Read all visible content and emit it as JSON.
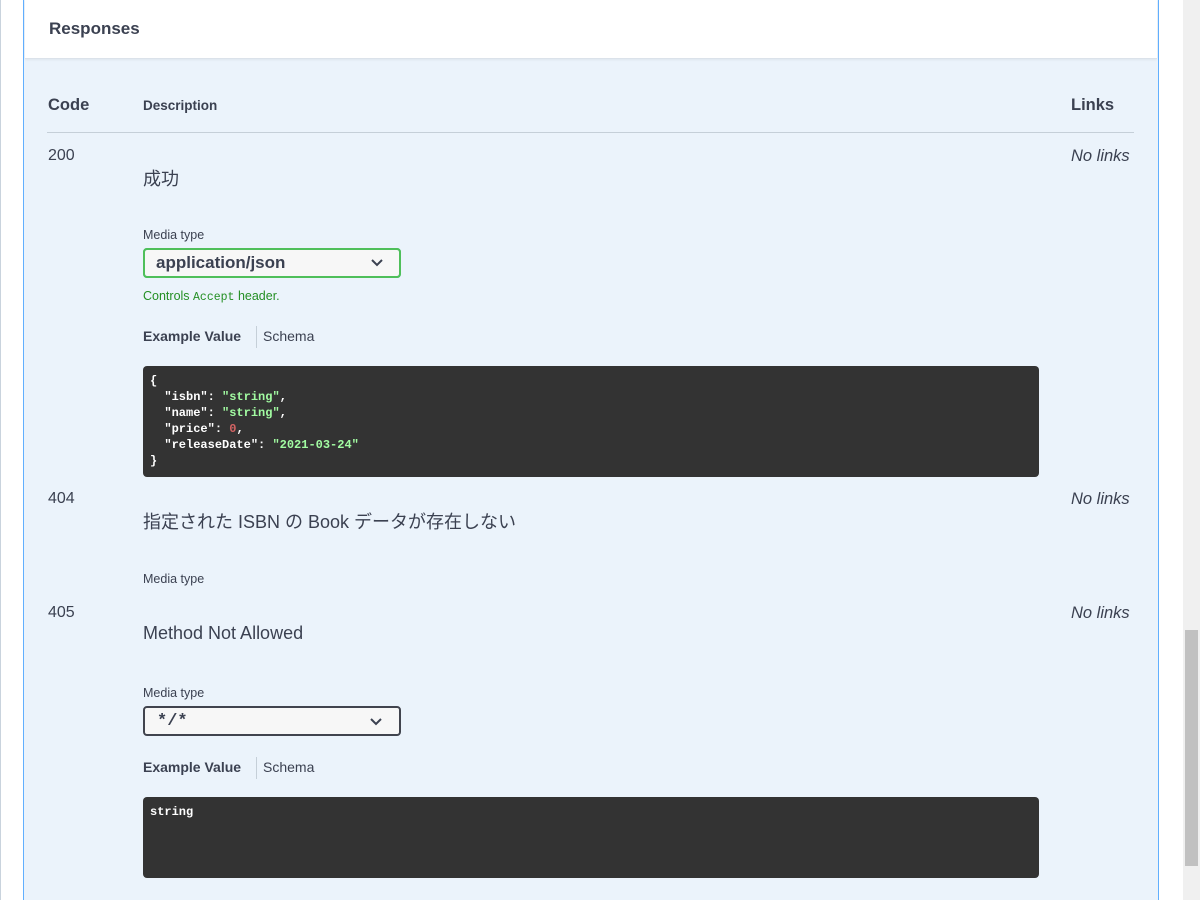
{
  "responses": {
    "title": "Responses",
    "columns": {
      "code": "Code",
      "description": "Description",
      "links": "Links"
    },
    "items": [
      {
        "code": "200",
        "description": "成功",
        "links": "No links",
        "media_type_label": "Media type",
        "media_type_value": "application/json",
        "controls_prefix": "Controls",
        "controls_code": "Accept",
        "controls_suffix": "header.",
        "tab_example": "Example Value",
        "tab_schema": "Schema",
        "example": [
          {
            "text": "{",
            "type": "plain"
          },
          {
            "key": "\"isbn\"",
            "value": "\"string\"",
            "type": "str",
            "trail": ","
          },
          {
            "key": "\"name\"",
            "value": "\"string\"",
            "type": "str",
            "trail": ","
          },
          {
            "key": "\"price\"",
            "value": "0",
            "type": "num",
            "trail": ","
          },
          {
            "key": "\"releaseDate\"",
            "value": "\"2021-03-24\"",
            "type": "str",
            "trail": ""
          },
          {
            "text": "}",
            "type": "plain"
          }
        ]
      },
      {
        "code": "404",
        "description": "指定された ISBN の Book データが存在しない",
        "links": "No links",
        "media_type_label": "Media type"
      },
      {
        "code": "405",
        "description": "Method Not Allowed",
        "links": "No links",
        "media_type_label": "Media type",
        "media_type_value": "*/*",
        "tab_example": "Example Value",
        "tab_schema": "Schema",
        "example_text": "string"
      }
    ]
  },
  "icons": {
    "dropdown": "chevron-down-icon"
  },
  "colors": {
    "panel_bg": "#ebf3fb",
    "panel_border": "#61affe",
    "code_bg": "#333333",
    "string_token": "#a2fca2",
    "number_token": "#d36363",
    "success_green": "#248f24"
  }
}
